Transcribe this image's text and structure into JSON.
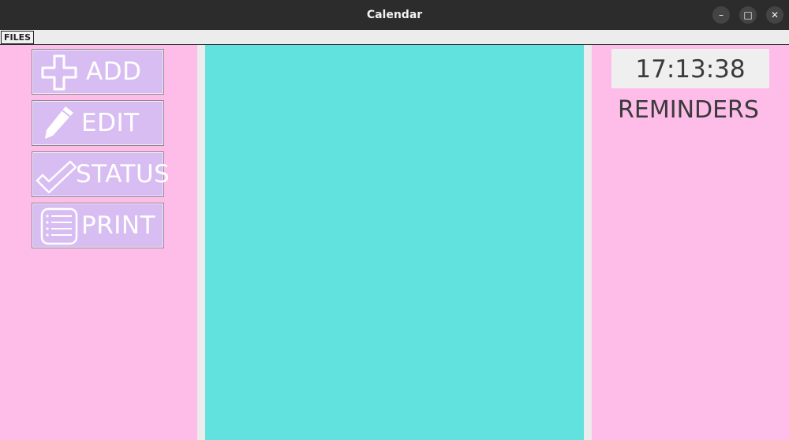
{
  "window": {
    "title": "Calendar",
    "minimize_glyph": "–",
    "maximize_glyph": "□",
    "close_glyph": "✕"
  },
  "menu": {
    "files_label": "FILES"
  },
  "sidebar": {
    "buttons": [
      {
        "label": "ADD",
        "icon": "plus-icon"
      },
      {
        "label": "EDIT",
        "icon": "pencil-icon"
      },
      {
        "label": "STATUS",
        "icon": "checkmark-icon"
      },
      {
        "label": "PRINT",
        "icon": "checklist-icon"
      }
    ]
  },
  "right_panel": {
    "clock": "17:13:38",
    "reminders_title": "REMINDERS"
  },
  "colors": {
    "side_panel_bg": "#febde9",
    "center_panel_bg": "#62e2de",
    "button_bg": "#d8bdf3",
    "titlebar_bg": "#2c2c2c"
  }
}
